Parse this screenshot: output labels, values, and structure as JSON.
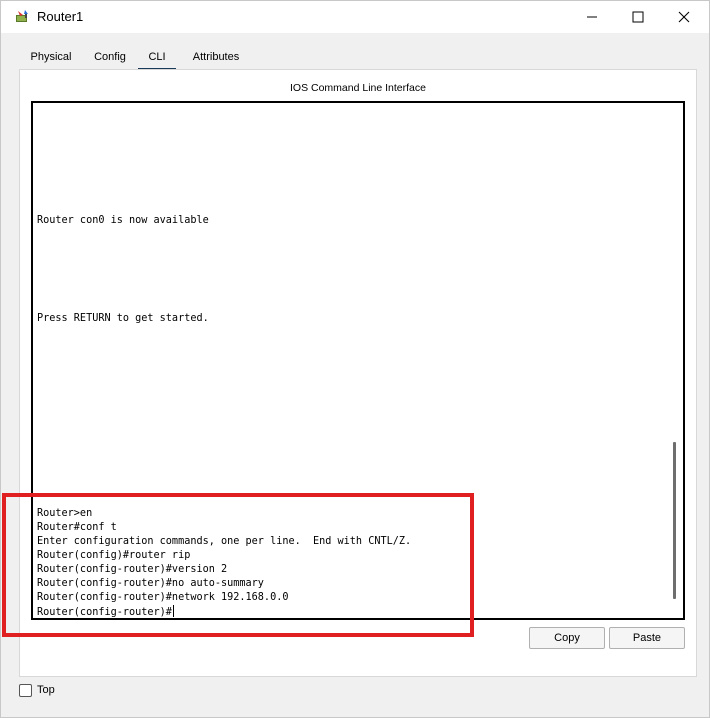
{
  "window": {
    "title": "Router1",
    "icon": "router-app-icon"
  },
  "tabs": [
    {
      "label": "Physical",
      "active": false
    },
    {
      "label": "Config",
      "active": false
    },
    {
      "label": "CLI",
      "active": true
    },
    {
      "label": "Attributes",
      "active": false
    }
  ],
  "cli": {
    "panel_title": "IOS Command Line Interface",
    "lines": [
      "Router con0 is now available",
      "Press RETURN to get started.",
      "Router>en",
      "Router#conf t",
      "Enter configuration commands, one per line.  End with CNTL/Z.",
      "Router(config)#router rip",
      "Router(config-router)#version 2",
      "Router(config-router)#no auto-summary",
      "Router(config-router)#network 192.168.0.0",
      "Router(config-router)#"
    ]
  },
  "buttons": {
    "copy": "Copy",
    "paste": "Paste"
  },
  "footer": {
    "top_label": "Top",
    "top_checked": false
  },
  "colors": {
    "highlight": "#e02020",
    "active_tab_underline": "#1a3a5a"
  }
}
